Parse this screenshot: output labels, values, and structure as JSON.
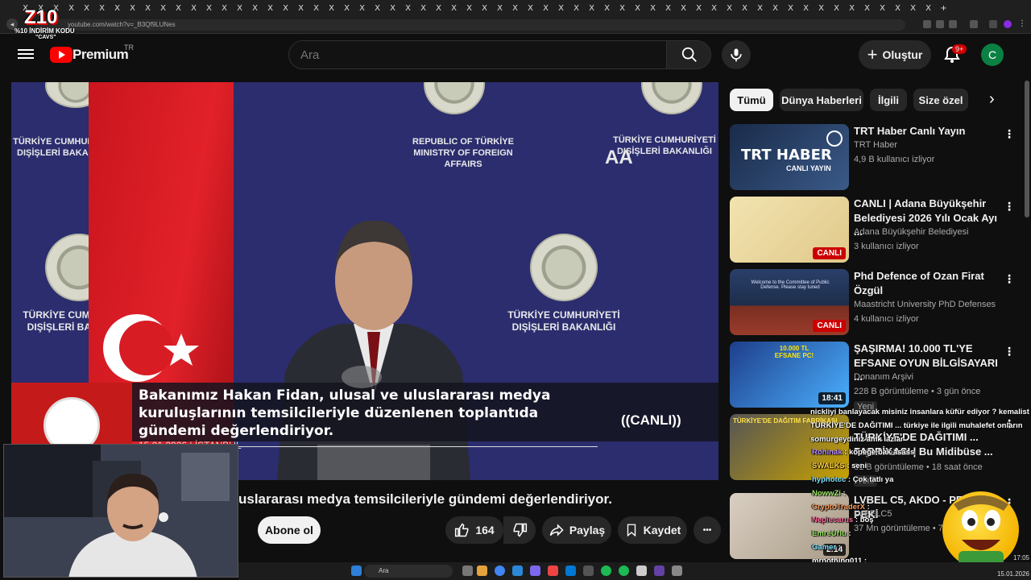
{
  "browser": {
    "tab_glyph": "X",
    "tab_count": 60,
    "new_tab": "+",
    "url": "youtube.com/watch?v=_B3Qf9LUNes"
  },
  "overlay": {
    "brand_big": "Z10",
    "discount": "%10 İNDİRİM KODU",
    "code": "\"CAVS\""
  },
  "header": {
    "brand": "Premium",
    "country": "TR",
    "search_placeholder": "Ara",
    "create_label": "Oluştur",
    "notif_badge": "9+",
    "avatar_letter": "C"
  },
  "player": {
    "lower_third": "Bakanımız Hakan Fidan, ulusal ve uluslararası medya kuruluşlarının temsilcileriyle düzenlenen toplantıda gündemi değerlendiriyor.",
    "date_place": "15.01.2026 | İSTANBUL",
    "live_tag": "CANLI",
    "backdrop_tr": "TÜRKİYE CUMHURİYETİ DIŞİŞLERİ BAKANLIĞI",
    "backdrop_tr_left": "TÜRKİYE CUMHURİYETİ DIŞİŞLERİ BAKANLIĞI",
    "backdrop_top_left": "TÜRKİYE CUMHURİYETİ DIŞİŞLERİ BAKANLIĞI",
    "backdrop_en": "REPUBLIC OF TÜRKİYE MINISTRY OF FOREIGN AFFAIRS",
    "backdrop_right": "TÜRKİYE CUMHURİYETİ DIŞİŞLERİ BAKANLIĞI",
    "agency": "AA"
  },
  "video": {
    "title_visible": "uslararası medya temsilcileriyle gündemi değerlendiriyor.",
    "subscribe": "Abone ol",
    "likes": "164",
    "share": "Paylaş",
    "save": "Kaydet",
    "more": "•••"
  },
  "chips": [
    "Tümü",
    "Dünya Haberleri",
    "İlgili",
    "Size özel"
  ],
  "recs": [
    {
      "title": "TRT Haber Canlı Yayın",
      "channel": "TRT Haber",
      "meta": "4,9 B kullanıcı izliyor",
      "thumb_text": "TRT HABER",
      "thumb_sub": "CANLI YAYIN"
    },
    {
      "title": "CANLI | Adana Büyükşehir Belediyesi 2026 Yılı Ocak Ayı ...",
      "channel": "Adana Büyükşehir Belediyesi",
      "meta": "3 kullanıcı izliyor",
      "tag": "CANLI"
    },
    {
      "title": "Phd Defence of Ozan Firat Özgül",
      "channel": "Maastricht University PhD Defenses",
      "meta": "4 kullanıcı izliyor",
      "tag": "CANLI",
      "thumb_text": "Welcome to the Committee of Public Defense. Please stay tuned"
    },
    {
      "title": "ŞAŞIRMA! 10.000 TL'YE EFSANE OYUN BİLGİSAYARI ...",
      "channel": "Donanım Arşivi",
      "meta": "228 B görüntüleme • 3 gün önce",
      "duration": "18:41",
      "extra": "Yeni",
      "thumb_text": "10.000 TL EFSANE PC!"
    },
    {
      "title": "TÜRKİYE'DE DAĞITIMI ... FABRİKASI | Bu Midibüse ...",
      "channel": "Doğan Kabak",
      "meta": "81 B görüntüleme • 18 saat önce",
      "extra": "Yeni",
      "thumb_text": "TÜRKİYE'DE DAĞITIM FABRİKASI"
    },
    {
      "title": "LVBEL C5, AKDO - PEKİ PEKİ",
      "channel": "LVBELC5",
      "meta": "37 Mn görüntüleme • 7 ay önce",
      "duration": "2:14"
    }
  ],
  "chat": [
    {
      "user": "",
      "msg": "nickliyi banlayacak misiniz insanlara küfür ediyor ? kemalist"
    },
    {
      "user": "",
      "msg": "TÜRKİYE'DE DAĞITIMI ... türkiye ile ilgili muhalefet onların"
    },
    {
      "user": "",
      "msg": "somurgeydiniz amk lazlar"
    },
    {
      "user": "Rohinak",
      "msg": "köpeğe bak asass"
    },
    {
      "user": "SWALKS",
      "msg": "seni"
    },
    {
      "user": "hyphotcc",
      "msg": "Çok tatlı ya"
    },
    {
      "user": "NowwZi",
      "msg": ""
    },
    {
      "user": "CryptoTraderX",
      "msg": ""
    },
    {
      "user": "Neplecarus",
      "msg": "boş"
    },
    {
      "user": "EmreUrlu",
      "msg": ""
    },
    {
      "user": "Gamer",
      "msg": ""
    },
    {
      "user": "mrnothing011",
      "msg": ""
    },
    {
      "user": "Salamcan",
      "msg": ""
    }
  ],
  "taskbar": {
    "search": "Ara",
    "time": "17:05",
    "date": "15.01.2026"
  }
}
